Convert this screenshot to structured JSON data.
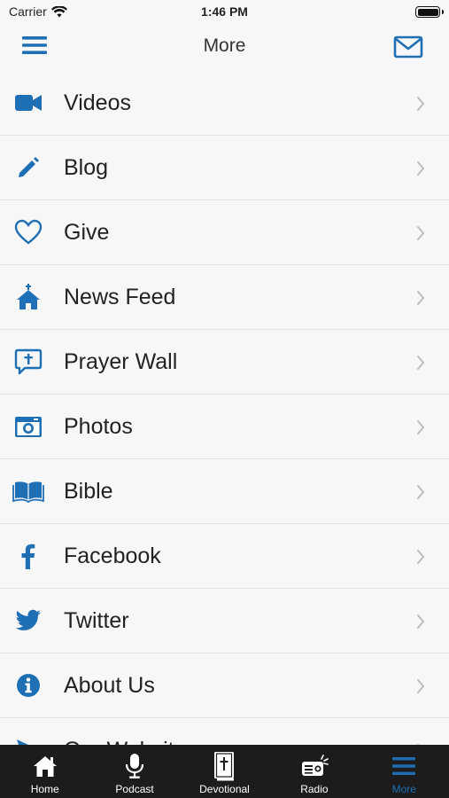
{
  "status_bar": {
    "carrier": "Carrier",
    "time": "1:46 PM"
  },
  "nav": {
    "title": "More",
    "menu_icon": "hamburger-icon",
    "mail_icon": "mail-icon"
  },
  "colors": {
    "accent": "#1f6fb5",
    "tab_bar_bg": "#1c1c1c",
    "divider": "#e3e3e3",
    "chevron": "#bdbdbd"
  },
  "menu": {
    "items": [
      {
        "label": "Videos",
        "icon": "video-camera-icon"
      },
      {
        "label": "Blog",
        "icon": "pencil-icon"
      },
      {
        "label": "Give",
        "icon": "heart-icon"
      },
      {
        "label": "News Feed",
        "icon": "church-icon"
      },
      {
        "label": "Prayer Wall",
        "icon": "prayer-bubble-icon"
      },
      {
        "label": "Photos",
        "icon": "camera-icon"
      },
      {
        "label": "Bible",
        "icon": "open-book-icon"
      },
      {
        "label": "Facebook",
        "icon": "facebook-icon"
      },
      {
        "label": "Twitter",
        "icon": "twitter-icon"
      },
      {
        "label": "About Us",
        "icon": "info-icon"
      },
      {
        "label": "Our Website",
        "icon": "send-icon"
      }
    ]
  },
  "tab_bar": {
    "tabs": [
      {
        "label": "Home",
        "icon": "home-icon",
        "active": false
      },
      {
        "label": "Podcast",
        "icon": "microphone-icon",
        "active": false
      },
      {
        "label": "Devotional",
        "icon": "bible-icon",
        "active": false
      },
      {
        "label": "Radio",
        "icon": "radio-icon",
        "active": false
      },
      {
        "label": "More",
        "icon": "hamburger-icon",
        "active": true
      }
    ]
  }
}
